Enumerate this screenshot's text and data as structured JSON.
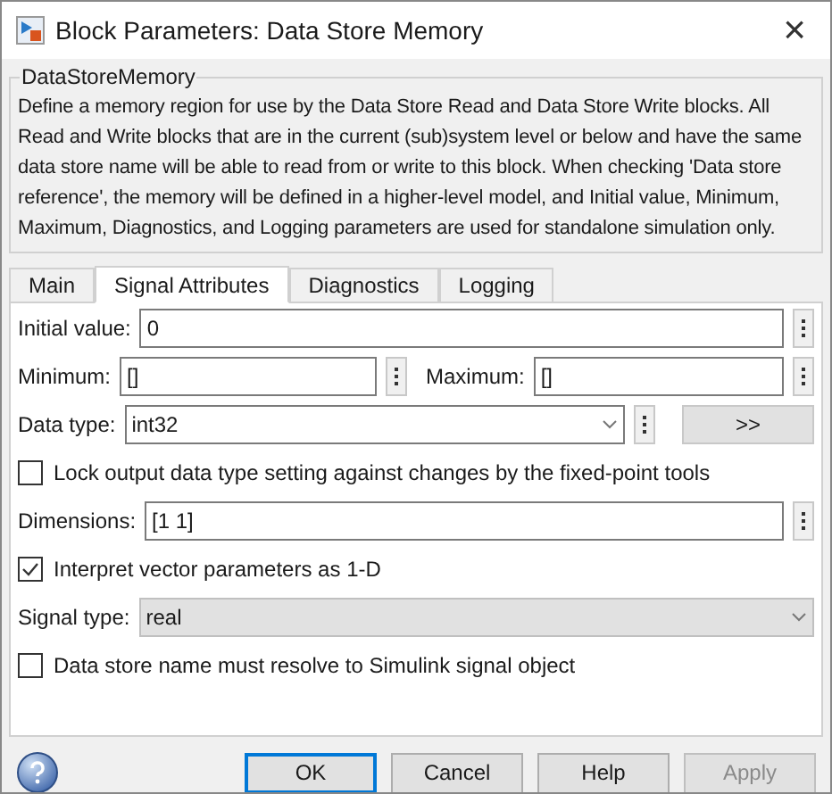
{
  "window": {
    "title": "Block Parameters: Data Store Memory",
    "close": "×"
  },
  "description": {
    "title": "DataStoreMemory",
    "text": "Define a memory region for use by the Data Store Read and Data Store Write blocks. All Read and Write blocks that are in the current (sub)system level or below and have the same data store name will be able to read from or write to this block. When checking 'Data store reference', the memory will be defined in a higher-level model, and Initial value, Minimum, Maximum, Diagnostics, and Logging parameters are used for standalone simulation only."
  },
  "tabs": [
    {
      "label": "Main",
      "selected": false
    },
    {
      "label": "Signal Attributes",
      "selected": true
    },
    {
      "label": "Diagnostics",
      "selected": false
    },
    {
      "label": "Logging",
      "selected": false
    }
  ],
  "rows": [
    {
      "kind": "text",
      "label": "Initial value:",
      "value": "0"
    },
    {
      "kind": "pair",
      "fields": [
        {
          "label": "Minimum:",
          "value": "[]"
        },
        {
          "label": "Maximum:",
          "value": "[]"
        }
      ]
    },
    {
      "kind": "datatype",
      "label": "Data type:",
      "value": "int32",
      "button": ">>"
    },
    {
      "kind": "checkbox",
      "label": "Lock output data type setting against changes by the fixed-point tools",
      "checked": false
    },
    {
      "kind": "text",
      "label": "Dimensions:",
      "value": "[1 1]"
    },
    {
      "kind": "checkbox",
      "label": "Interpret vector parameters as 1-D",
      "checked": true
    },
    {
      "kind": "select",
      "label": "Signal type:",
      "value": "real"
    },
    {
      "kind": "checkbox",
      "label": "Data store name must resolve to Simulink signal object",
      "checked": false
    }
  ],
  "buttons": [
    {
      "label": "OK",
      "default": true,
      "disabled": false
    },
    {
      "label": "Cancel",
      "default": false,
      "disabled": false
    },
    {
      "label": "Help",
      "default": false,
      "disabled": false
    },
    {
      "label": "Apply",
      "default": false,
      "disabled": true
    }
  ]
}
